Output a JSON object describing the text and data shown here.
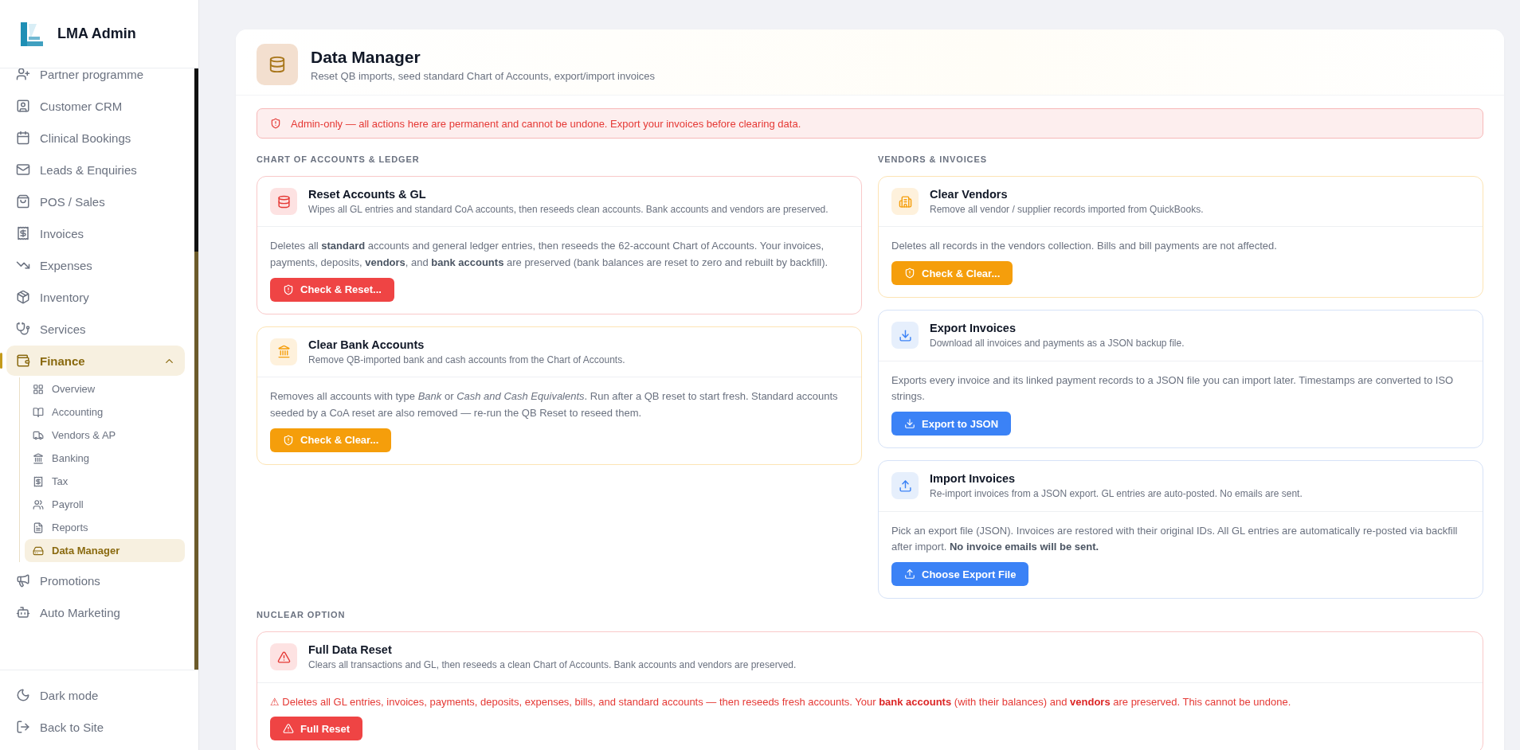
{
  "sidebar": {
    "brand": "LMA Admin",
    "items": [
      {
        "label": "Partner programme",
        "selected": false
      },
      {
        "label": "Customer CRM",
        "selected": false
      },
      {
        "label": "Clinical Bookings",
        "selected": false
      },
      {
        "label": "Leads & Enquiries",
        "selected": false
      },
      {
        "label": "POS / Sales",
        "selected": false
      },
      {
        "label": "Invoices",
        "selected": false
      },
      {
        "label": "Expenses",
        "selected": false
      },
      {
        "label": "Inventory",
        "selected": false
      },
      {
        "label": "Services",
        "selected": false
      },
      {
        "label": "Finance",
        "selected": true,
        "expanded": true,
        "children": [
          {
            "label": "Overview",
            "selected": false
          },
          {
            "label": "Accounting",
            "selected": false
          },
          {
            "label": "Vendors & AP",
            "selected": false
          },
          {
            "label": "Banking",
            "selected": false
          },
          {
            "label": "Tax",
            "selected": false
          },
          {
            "label": "Payroll",
            "selected": false
          },
          {
            "label": "Reports",
            "selected": false
          },
          {
            "label": "Data Manager",
            "selected": true
          }
        ]
      },
      {
        "label": "Promotions",
        "selected": false
      },
      {
        "label": "Auto Marketing",
        "selected": false
      }
    ],
    "footer": [
      "Dark mode",
      "Back to Site"
    ]
  },
  "header": {
    "title": "Data Manager",
    "subtitle": "Reset QB imports, seed standard Chart of Accounts, export/import invoices"
  },
  "alert": "Admin-only — all actions here are permanent and cannot be undone. Export your invoices before clearing data.",
  "sections": [
    {
      "heading": "CHART OF ACCOUNTS & LEDGER",
      "cards": [
        {
          "kind": "reset",
          "title": "Reset Accounts & GL",
          "subtitle": "Wipes all GL entries and standard CoA accounts, then reseeds clean accounts. Bank accounts and vendors are preserved.",
          "body": "Deletes all **standard** accounts and general ledger entries, then reseeds the 62-account Chart of Accounts. Your invoices, payments, deposits, **vendors**, and **bank accounts** are preserved (bank balances are reset to zero and rebuilt by backfill).",
          "button": "Check & Reset..."
        },
        {
          "kind": "bank",
          "title": "Clear Bank Accounts",
          "subtitle": "Remove QB-imported bank and cash accounts from the Chart of Accounts.",
          "body": "Removes all accounts with type *Bank* or *Cash and Cash Equivalents*. Run after a QB reset to start fresh. Standard accounts seeded by a CoA reset are also removed — re-run the QB Reset to reseed them.",
          "button": "Check & Clear..."
        }
      ]
    },
    {
      "heading": "VENDORS & INVOICES",
      "cards": [
        {
          "kind": "vendors",
          "title": "Clear Vendors",
          "subtitle": "Remove all vendor / supplier records imported from QuickBooks.",
          "body": "Deletes all records in the vendors collection. Bills and bill payments are not affected.",
          "button": "Check & Clear..."
        },
        {
          "kind": "export",
          "title": "Export Invoices",
          "subtitle": "Download all invoices and payments as a JSON backup file.",
          "body": "Exports every invoice and its linked payment records to a JSON file you can import later. Timestamps are converted to ISO strings.",
          "button": "Export to JSON"
        },
        {
          "kind": "import",
          "title": "Import Invoices",
          "subtitle": "Re-import invoices from a JSON export. GL entries are auto-posted. No emails are sent.",
          "body": "Pick an export file (JSON). Invoices are restored with their original IDs. All GL entries are automatically re-posted via backfill after import. **No invoice emails will be sent.**",
          "button": "Choose Export File"
        }
      ]
    },
    {
      "heading": "NUCLEAR OPTION",
      "cards": [
        {
          "kind": "nuclear",
          "title": "Full Data Reset",
          "subtitle": "Clears all transactions and GL, then reseeds a clean Chart of Accounts. Bank accounts and vendors are preserved.",
          "body": "⚠ Deletes all GL entries, invoices, payments, deposits, expenses, bills, and standard accounts — then reseeds fresh accounts. Your **bank accounts** (with their balances) and **vendors** are preserved. This cannot be undone.",
          "button": "Full Reset"
        }
      ]
    }
  ]
}
